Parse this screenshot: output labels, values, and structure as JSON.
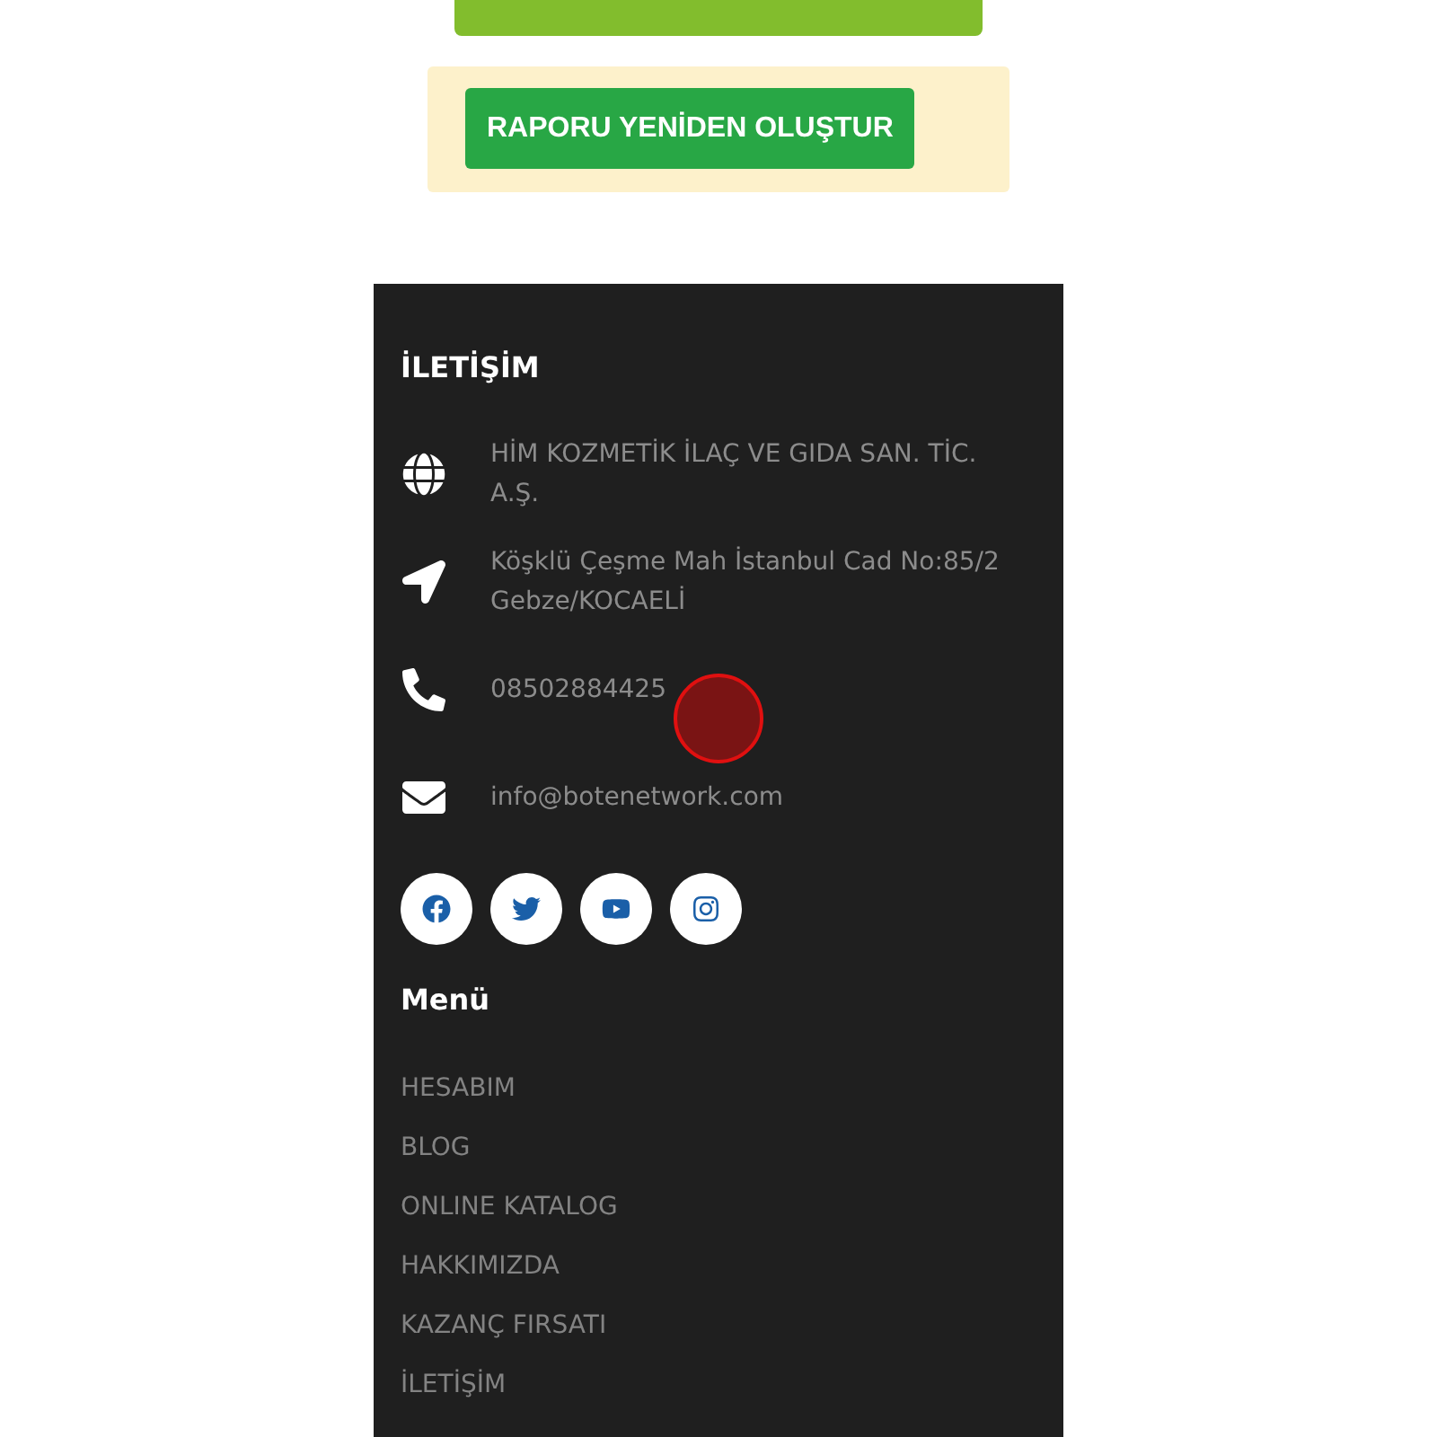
{
  "refresh_button": {
    "kind": "cut"
  },
  "regenerate_button": {
    "label": "RAPORU YENİDEN OLUŞTUR"
  },
  "footer": {
    "contact_title": "İLETİŞİM",
    "contacts": [
      {
        "kind": "company",
        "text": "HİM KOZMETİK İLAÇ VE GIDA SAN. TİC. A.Ş."
      },
      {
        "kind": "address",
        "text": "Köşklü Çeşme Mah İstanbul Cad No:85/2 Gebze/KOCAELİ"
      },
      {
        "kind": "phone",
        "text": "08502884425"
      },
      {
        "kind": "email",
        "text": "info@botenetwork.com"
      }
    ],
    "socials": [
      {
        "kind": "facebook"
      },
      {
        "kind": "twitter"
      },
      {
        "kind": "youtube"
      },
      {
        "kind": "instagram"
      }
    ],
    "menu_title": "Menü",
    "menu_items": [
      "HESABIM",
      "BLOG",
      "ONLINE KATALOG",
      "HAKKIMIZDA",
      "KAZANÇ FIRSATI",
      "İLETİŞİM"
    ]
  }
}
